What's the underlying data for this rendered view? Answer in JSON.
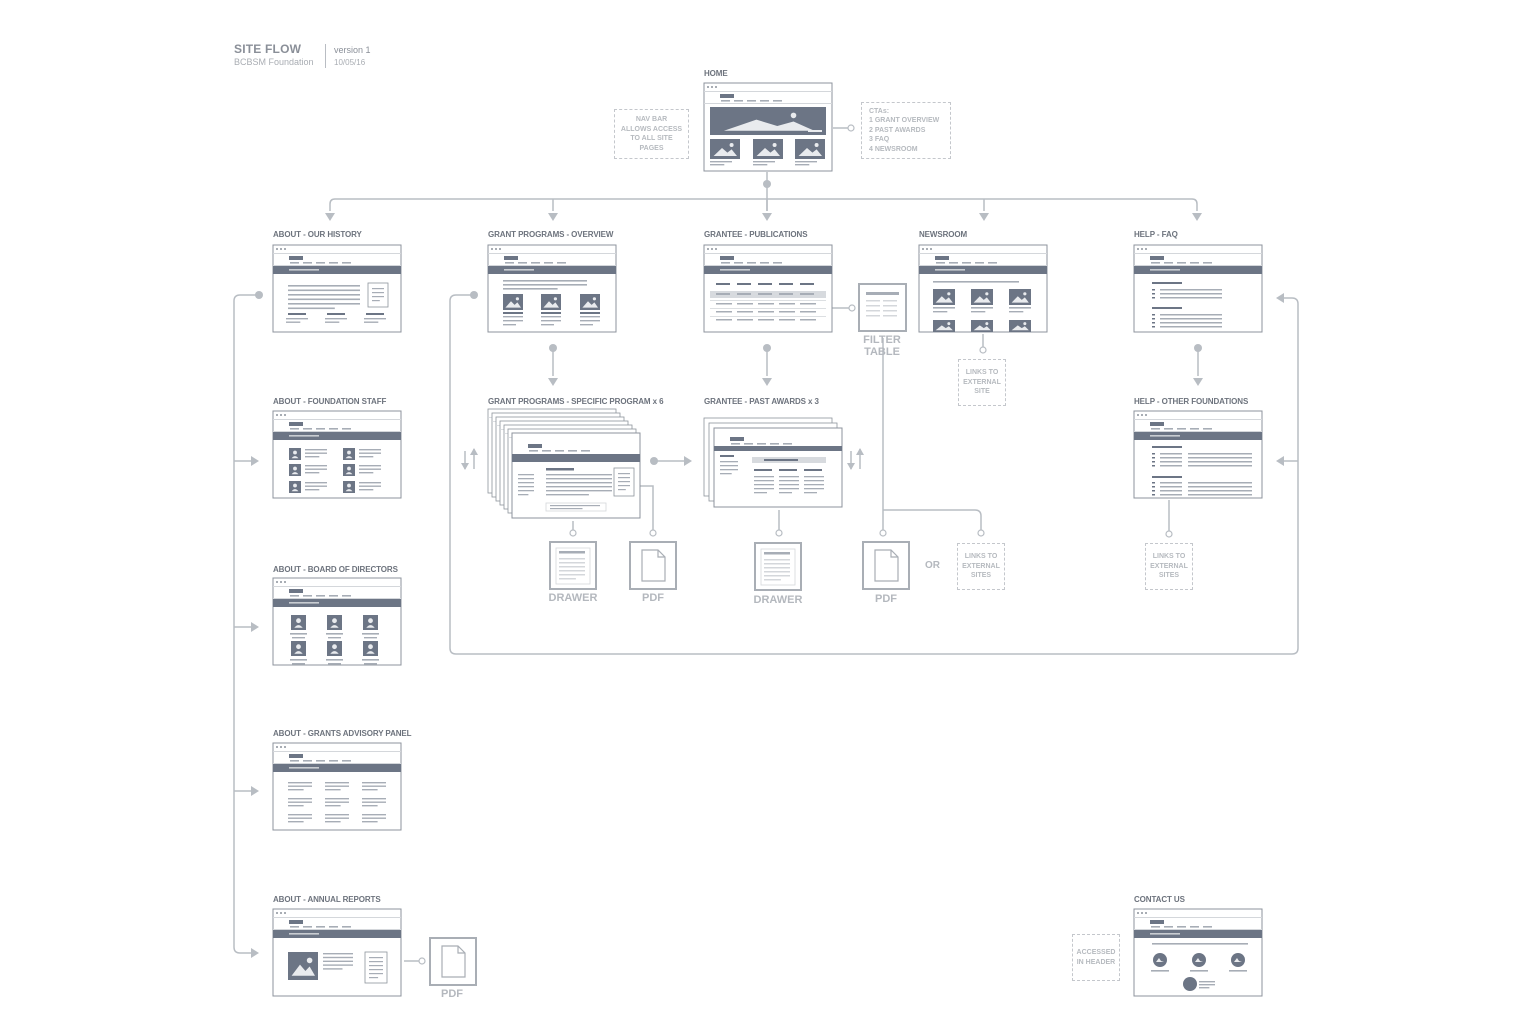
{
  "header": {
    "title": "SITE FLOW",
    "subtitle": "BCBSM Foundation",
    "version": "version 1",
    "date": "10/05/16"
  },
  "pages": {
    "home": "HOME",
    "about_history": "ABOUT - OUR HISTORY",
    "grant_overview": "GRANT PROGRAMS - OVERVIEW",
    "grantee_publications": "GRANTEE - PUBLICATIONS",
    "newsroom": "NEWSROOM",
    "help_faq": "HELP - FAQ",
    "about_staff": "ABOUT - FOUNDATION STAFF",
    "grant_specific": "GRANT PROGRAMS - SPECIFIC PROGRAM x 6",
    "grantee_past_awards": "GRANTEE - PAST AWARDS x 3",
    "help_other": "HELP - OTHER FOUNDATIONS",
    "about_board": "ABOUT - BOARD OF DIRECTORS",
    "about_advisory": "ABOUT - GRANTS ADVISORY PANEL",
    "about_reports": "ABOUT - ANNUAL REPORTS",
    "contact": "CONTACT US"
  },
  "notes": {
    "nav_bar": "NAV BAR\nALLOWS ACCESS\nTO ALL SITE\nPAGES",
    "ctas": "CTAs:\n1  GRANT OVERVIEW\n2  PAST AWARDS\n3  FAQ\n4  NEWSROOM",
    "newsroom_links": "LINKS TO\nEXTERNAL\nSITE",
    "external_sites": "LINKS TO\nEXTERNAL\nSITES",
    "help_links": "LINKS TO\nEXTERNAL\nSITES",
    "header_access": "ACCESSED\nIN HEADER"
  },
  "labels": {
    "filter_table": "FILTER\nTABLE",
    "drawer": "DRAWER",
    "pdf": "PDF",
    "or": "OR"
  }
}
